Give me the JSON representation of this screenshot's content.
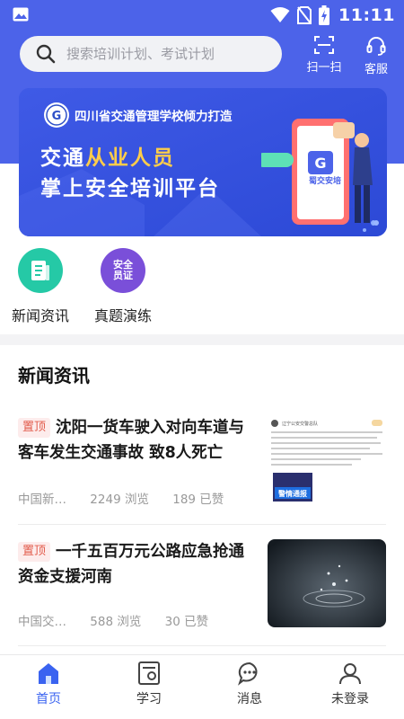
{
  "status_bar": {
    "time": "11:11"
  },
  "header": {
    "search_placeholder": "搜索培训计划、考试计划",
    "scan_label": "扫一扫",
    "service_label": "客服"
  },
  "banner": {
    "org": "四川省交通管理学校倾力打造",
    "line1_pre": "交通",
    "line1_highlight": "从业人员",
    "line2": "掌上安全培训平台",
    "app_label": "蜀交安培"
  },
  "quick_entries": [
    {
      "label": "新闻资讯",
      "icon": "news-icon"
    },
    {
      "label": "真题演练",
      "icon_text_1": "安全",
      "icon_text_2": "员证"
    }
  ],
  "news": {
    "section_title": "新闻资讯",
    "items": [
      {
        "pin": "置顶",
        "title": "沈阳一货车驶入对向车道与客车发生交通事故 致8人死亡",
        "source": "中国新…",
        "views": "2249 浏览",
        "likes": "189 已赞",
        "thumb_badge": "警情通报",
        "thumb_header": "辽宁公安交警总队"
      },
      {
        "pin": "置顶",
        "title": "一千五百万元公路应急抢通资金支援河南",
        "source": "中国交…",
        "views": "588 浏览",
        "likes": "30 已赞"
      }
    ]
  },
  "tabbar": {
    "tabs": [
      {
        "label": "首页"
      },
      {
        "label": "学习"
      },
      {
        "label": "消息"
      },
      {
        "label": "未登录"
      }
    ],
    "active_color": "#3a63f0"
  },
  "colors": {
    "brand": "#4c63e9",
    "accent_yellow": "#ffcd4a",
    "pin_red": "#e25b4b"
  }
}
